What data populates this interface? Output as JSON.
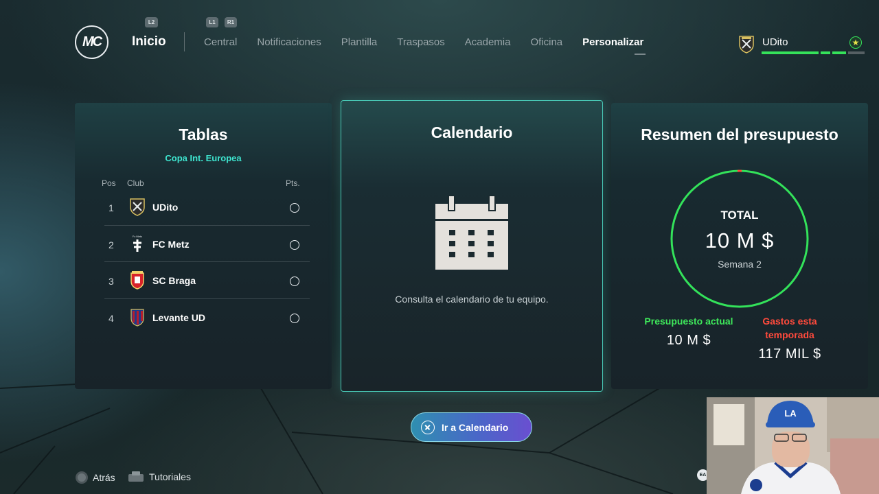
{
  "nav": {
    "inicio": "Inicio",
    "hints": {
      "l2": "L2",
      "l1": "L1",
      "r1": "R1"
    },
    "items": [
      {
        "label": "Central",
        "active": false
      },
      {
        "label": "Notificaciones",
        "active": false
      },
      {
        "label": "Plantilla",
        "active": false
      },
      {
        "label": "Traspasos",
        "active": false
      },
      {
        "label": "Academia",
        "active": false
      },
      {
        "label": "Oficina",
        "active": false
      },
      {
        "label": "Personalizar",
        "active": true
      }
    ]
  },
  "logo": {
    "text": "MC"
  },
  "user": {
    "name": "UDito",
    "icon": "star-icon"
  },
  "tablas": {
    "title": "Tablas",
    "competition": "Copa Int. Europea",
    "headers": {
      "pos": "Pos",
      "club": "Club",
      "pts": "Pts."
    },
    "rows": [
      {
        "pos": "1",
        "club": "UDito",
        "crest": "udito-crest-icon"
      },
      {
        "pos": "2",
        "club": "FC Metz",
        "crest": "fc-metz-crest-icon"
      },
      {
        "pos": "3",
        "club": "SC Braga",
        "crest": "sc-braga-crest-icon"
      },
      {
        "pos": "4",
        "club": "Levante UD",
        "crest": "levante-crest-icon"
      }
    ]
  },
  "calendario": {
    "title": "Calendario",
    "description": "Consulta el calendario de tu equipo.",
    "button": "Ir a Calendario"
  },
  "presupuesto": {
    "title": "Resumen del presupuesto",
    "total_label": "TOTAL",
    "total_value": "10 M $",
    "week": "Semana 2",
    "actual_label": "Presupuesto actual",
    "actual_value": "10 M $",
    "gastos_label": "Gastos esta temporada",
    "gastos_value": "117 MIL $"
  },
  "footer": {
    "back": "Atrás",
    "tutorials": "Tutoriales"
  },
  "colors": {
    "accent_teal": "#3ee6d0",
    "green": "#35e25a",
    "red": "#ff4a3c",
    "button_purple": "#4a67c8"
  }
}
